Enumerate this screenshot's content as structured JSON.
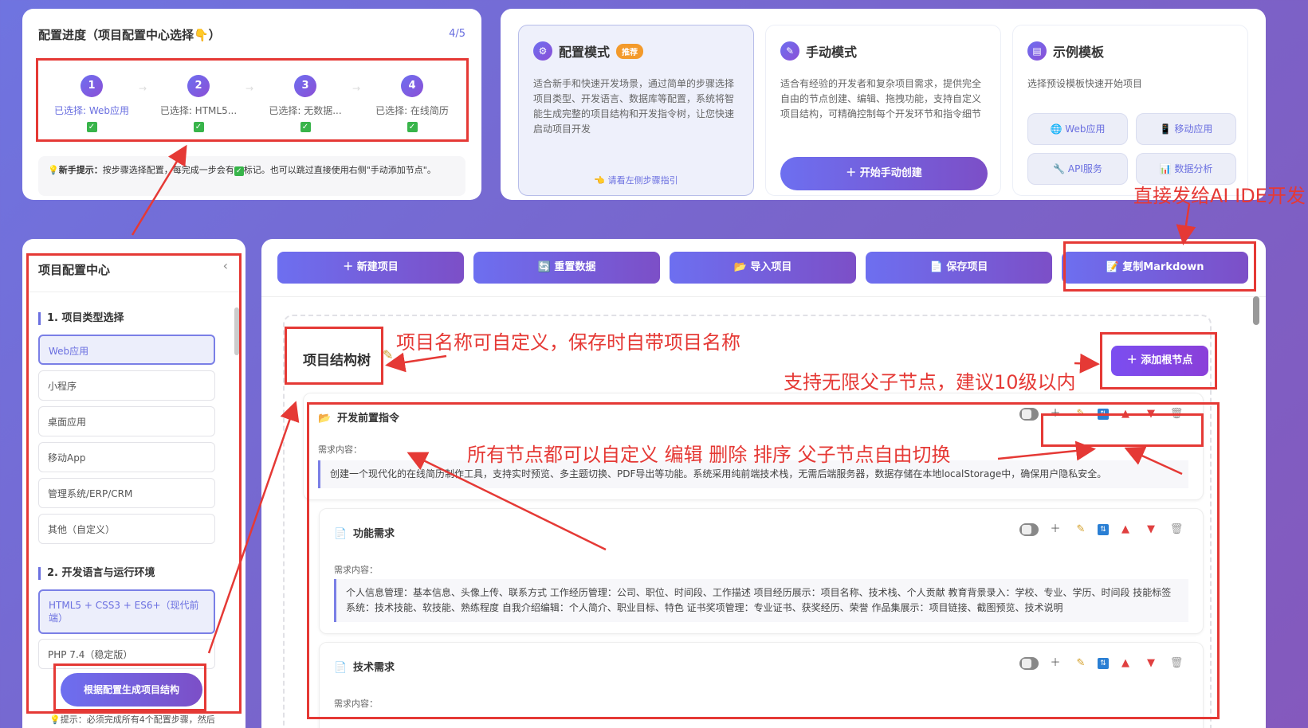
{
  "progress": {
    "title": "配置进度（项目配置中心选择👇）",
    "count": "4/5",
    "steps": [
      {
        "num": "1",
        "label": "已选择: Web应用",
        "check": "✓"
      },
      {
        "num": "2",
        "label": "已选择: HTML5...",
        "check": "✓"
      },
      {
        "num": "3",
        "label": "已选择: 无数据...",
        "check": "✓"
      },
      {
        "num": "4",
        "label": "已选择: 在线简历",
        "check": "✓"
      }
    ],
    "tip_bold": "新手提示：",
    "tip_text1": "按步骤选择配置，每完成一步会有",
    "tip_text2": "标记。也可以跳过直接使用右侧\"手动添加节点\"。"
  },
  "modes": {
    "config": {
      "title": "配置模式",
      "badge": "推荐",
      "desc": "适合新手和快速开发场景，通过简单的步骤选择项目类型、开发语言、数据库等配置，系统将智能生成完整的项目结构和开发指令树，让您快速启动项目开发",
      "hint": "👈 请看左侧步骤指引"
    },
    "manual": {
      "title": "手动模式",
      "desc": "适合有经验的开发者和复杂项目需求，提供完全自由的节点创建、编辑、拖拽功能，支持自定义项目结构，可精确控制每个开发环节和指令细节",
      "button": "开始手动创建"
    },
    "templates": {
      "title": "示例模板",
      "desc": "选择预设模板快速开始项目",
      "items": [
        "Web应用",
        "移动应用",
        "API服务",
        "数据分析"
      ]
    }
  },
  "sidebar": {
    "title": "项目配置中心",
    "collapse": "‹",
    "section1": "1. 项目类型选择",
    "types": [
      "Web应用",
      "小程序",
      "桌面应用",
      "移动App",
      "管理系统/ERP/CRM",
      "其他（自定义）"
    ],
    "section2": "2. 开发语言与运行环境",
    "langs": [
      "HTML5 + CSS3 + ES6+（现代前端）",
      "PHP 7.4（稳定版）"
    ],
    "generate": "根据配置生成项目结构",
    "tip": "💡提示：必须完成所有4个配置步骤，然后"
  },
  "toolbar": [
    "新建项目",
    "重置数据",
    "导入项目",
    "保存项目",
    "复制Markdown"
  ],
  "tree": {
    "title": "项目结构树",
    "add_root": "添加根节点",
    "nodes": [
      {
        "title": "开发前置指令",
        "req_label": "需求内容：",
        "content": "创建一个现代化的在线简历制作工具，支持实时预览、多主题切换、PDF导出等功能。系统采用纯前端技术栈，无需后端服务器，数据存储在本地localStorage中，确保用户隐私安全。"
      },
      {
        "title": "功能需求",
        "req_label": "需求内容：",
        "content": "个人信息管理：基本信息、头像上传、联系方式 工作经历管理：公司、职位、时间段、工作描述 项目经历展示：项目名称、技术栈、个人贡献 教育背景录入：学校、专业、学历、时间段 技能标签系统：技术技能、软技能、熟练程度 自我介绍编辑：个人简介、职业目标、特色 证书奖项管理：专业证书、获奖经历、荣誉 作品集展示：项目链接、截图预览、技术说明"
      },
      {
        "title": "技术需求",
        "req_label": "需求内容："
      }
    ]
  },
  "annotations": {
    "direct_ai": "直接发给AI IDE开发",
    "name_custom": "项目名称可自定义，保存时自带项目名称",
    "unlimited": "支持无限父子节点，建议10级以内",
    "node_custom": "所有节点都可以自定义  编辑  删除  排序   父子节点自由切换"
  }
}
